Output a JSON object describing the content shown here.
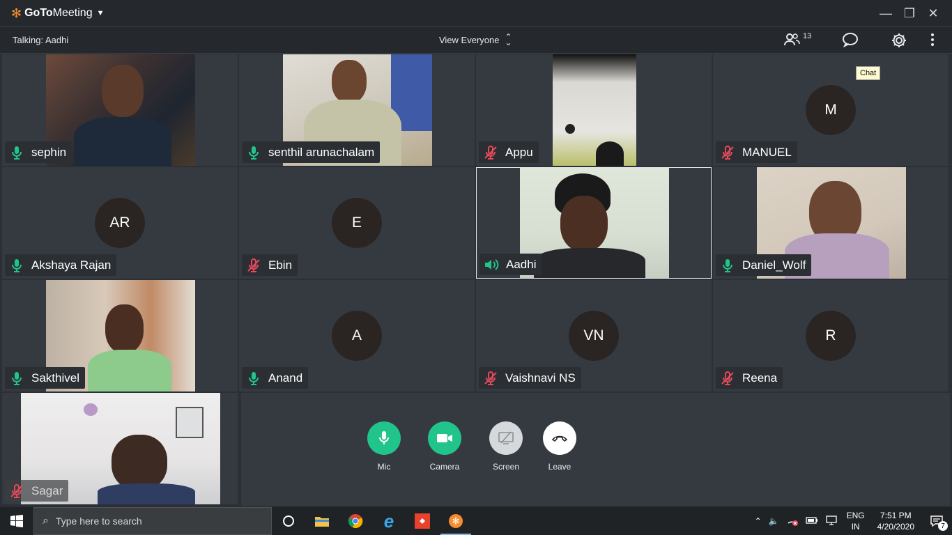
{
  "app": {
    "brand_bold": "GoTo",
    "brand_regular": "Meeting",
    "talking": "Talking: Aadhi",
    "view_label": "View Everyone",
    "people_count": "13",
    "tooltip": "Chat"
  },
  "participants": [
    {
      "name": "sephin",
      "mic": "on",
      "video": true
    },
    {
      "name": "senthil arunachalam",
      "mic": "on",
      "video": true
    },
    {
      "name": "Appu",
      "mic": "off",
      "video": true
    },
    {
      "name": "MANUEL",
      "mic": "off",
      "initials": "M"
    },
    {
      "name": "Akshaya Rajan",
      "mic": "on",
      "initials": "AR"
    },
    {
      "name": "Ebin",
      "mic": "off",
      "initials": "E"
    },
    {
      "name": "Aadhi",
      "mic": "speaking",
      "video": true
    },
    {
      "name": "Daniel_Wolf",
      "mic": "on",
      "video": true
    },
    {
      "name": "Sakthivel",
      "mic": "on",
      "video": true
    },
    {
      "name": "Anand",
      "mic": "on",
      "initials": "A"
    },
    {
      "name": "Vaishnavi NS",
      "mic": "off",
      "initials": "VN"
    },
    {
      "name": "Reena",
      "mic": "off",
      "initials": "R"
    },
    {
      "name": "Sagar",
      "mic": "off",
      "video": true
    }
  ],
  "controls": {
    "mic": "Mic",
    "camera": "Camera",
    "screen": "Screen",
    "leave": "Leave"
  },
  "taskbar": {
    "search_placeholder": "Type here to search",
    "lang_top": "ENG",
    "lang_bottom": "IN",
    "time": "7:51 PM",
    "date": "4/20/2020",
    "notifications": "7"
  },
  "colors": {
    "mic_on": "#21c48a",
    "mic_off": "#e5495a",
    "brand": "#f68d2e"
  }
}
